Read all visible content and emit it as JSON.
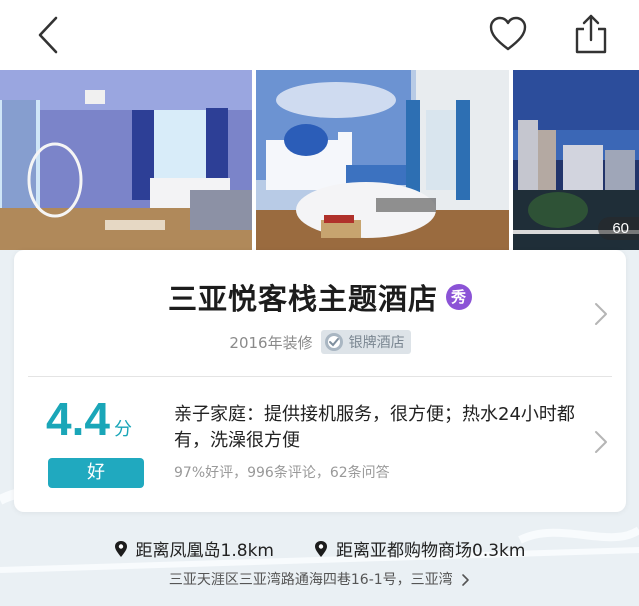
{
  "nav": {
    "back_icon": "chevron-left-icon",
    "favorite_icon": "heart-outline-icon",
    "share_icon": "share-icon"
  },
  "gallery": {
    "photo_count": "60"
  },
  "hotel": {
    "name": "三亚悦客栈主题酒店",
    "badge": "秀",
    "renovation": "2016年装修",
    "tier_label": "银牌酒店",
    "colors": {
      "accent": "#1aa6b8",
      "badge": "#8b53d6"
    }
  },
  "rating": {
    "score": "4.4",
    "unit": "分",
    "label": "好",
    "quote": "亲子家庭：提供接机服务，很方便；热水24小时都有，洗澡很方便",
    "stats": "97%好评，996条评论，62条问答"
  },
  "location": {
    "distance_1": "距离凤凰岛1.8km",
    "distance_2": "距离亚都购物商场0.3km",
    "address": "三亚天涯区三亚湾路通海四巷16-1号，三亚湾"
  }
}
